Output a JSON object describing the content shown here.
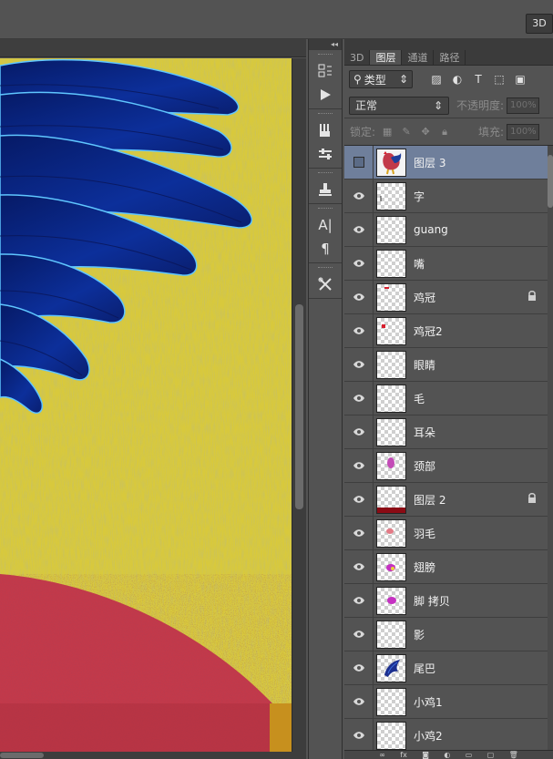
{
  "options_bar": {
    "mode_3d_label": "3D"
  },
  "panel_tabs": [
    {
      "label": "3D",
      "active": false
    },
    {
      "label": "图层",
      "active": true
    },
    {
      "label": "通道",
      "active": false
    },
    {
      "label": "路径",
      "active": false
    }
  ],
  "filter": {
    "kind_label": "类型",
    "kind_icon": "search-icon"
  },
  "blend": {
    "mode_label": "正常",
    "opacity_label": "不透明度:",
    "opacity_value": "100%"
  },
  "locks": {
    "label": "锁定:",
    "fill_label": "填充:",
    "fill_value": "100%"
  },
  "tools": [
    "history-icon",
    "play-icon",
    "brushes-icon",
    "adjust-icon",
    "stamp-icon",
    "character-icon",
    "paragraph-icon",
    "tools-icon"
  ],
  "layers": [
    {
      "name": "图层 3",
      "selected": true,
      "visible": false,
      "locked": false,
      "thumb": "rooster"
    },
    {
      "name": "字",
      "selected": false,
      "visible": true,
      "locked": false,
      "thumb": "tick"
    },
    {
      "name": "guang",
      "selected": false,
      "visible": true,
      "locked": false,
      "thumb": "empty"
    },
    {
      "name": "嘴",
      "selected": false,
      "visible": true,
      "locked": false,
      "thumb": "empty"
    },
    {
      "name": "鸡冠",
      "selected": false,
      "visible": true,
      "locked": true,
      "thumb": "comb"
    },
    {
      "name": "鸡冠2",
      "selected": false,
      "visible": true,
      "locked": false,
      "thumb": "comb2"
    },
    {
      "name": "眼睛",
      "selected": false,
      "visible": true,
      "locked": false,
      "thumb": "empty"
    },
    {
      "name": "毛",
      "selected": false,
      "visible": true,
      "locked": false,
      "thumb": "empty"
    },
    {
      "name": "耳朵",
      "selected": false,
      "visible": true,
      "locked": false,
      "thumb": "empty"
    },
    {
      "name": "颈部",
      "selected": false,
      "visible": true,
      "locked": false,
      "thumb": "neck"
    },
    {
      "name": "图层 2",
      "selected": false,
      "visible": true,
      "locked": true,
      "thumb": "bar"
    },
    {
      "name": "羽毛",
      "selected": false,
      "visible": true,
      "locked": false,
      "thumb": "feather"
    },
    {
      "name": "翅膀",
      "selected": false,
      "visible": true,
      "locked": false,
      "thumb": "wing"
    },
    {
      "name": "脚 拷贝",
      "selected": false,
      "visible": true,
      "locked": false,
      "thumb": "foot"
    },
    {
      "name": "影",
      "selected": false,
      "visible": true,
      "locked": false,
      "thumb": "empty"
    },
    {
      "name": "尾巴",
      "selected": false,
      "visible": true,
      "locked": false,
      "thumb": "tail"
    },
    {
      "name": "小鸡1",
      "selected": false,
      "visible": true,
      "locked": false,
      "thumb": "empty"
    },
    {
      "name": "小鸡2",
      "selected": false,
      "visible": true,
      "locked": false,
      "thumb": "empty"
    }
  ],
  "colors": {
    "selection": "#6f7f9b",
    "canvas_bg": "#d4c53a",
    "shape_red": "#c2394a",
    "feather_blue": "#0b2a8a"
  }
}
